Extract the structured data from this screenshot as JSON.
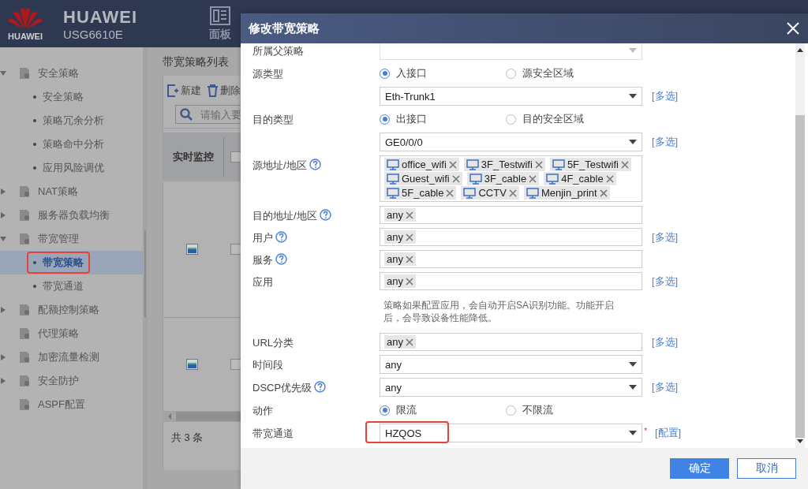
{
  "header": {
    "logo_text": "HUAWEI",
    "brand": "HUAWEI",
    "model": "USG6610E",
    "nav": [
      {
        "label": "面板"
      }
    ]
  },
  "sidebar": {
    "items": [
      {
        "label": "安全策略",
        "kind": "folder",
        "expanded": true,
        "children": [
          {
            "label": "安全策略",
            "selected": false,
            "highlighted": false
          },
          {
            "label": "策略冗余分析",
            "selected": false,
            "highlighted": false
          },
          {
            "label": "策略命中分析",
            "selected": false,
            "highlighted": false
          },
          {
            "label": "应用风险调优",
            "selected": false,
            "highlighted": false
          }
        ]
      },
      {
        "label": "NAT策略",
        "kind": "folder",
        "expanded": false
      },
      {
        "label": "服务器负载均衡",
        "kind": "folder",
        "expanded": false
      },
      {
        "label": "带宽管理",
        "kind": "folder",
        "expanded": true,
        "children": [
          {
            "label": "带宽策略",
            "selected": true,
            "highlighted": true
          },
          {
            "label": "带宽通道",
            "selected": false,
            "highlighted": false
          }
        ]
      },
      {
        "label": "配额控制策略",
        "kind": "folder",
        "expanded": false
      },
      {
        "label": "代理策略",
        "kind": "page"
      },
      {
        "label": "加密流量检测",
        "kind": "folder",
        "expanded": false
      },
      {
        "label": "安全防护",
        "kind": "folder",
        "expanded": false
      },
      {
        "label": "ASPF配置",
        "kind": "page"
      }
    ]
  },
  "list_panel": {
    "title": "带宽策略列表",
    "toolbar": [
      {
        "label": "新建",
        "kind": "new"
      },
      {
        "label": "删除",
        "kind": "delete"
      }
    ],
    "search": {
      "placeholder": "请输入要"
    },
    "columns": [
      "实时监控"
    ],
    "select_all": {
      "checked": false
    },
    "rows": [
      {
        "checked": false
      },
      {
        "checked": false
      }
    ],
    "footer": "共 3 条"
  },
  "dialog": {
    "title": "修改带宽策略",
    "fields": [
      {
        "label": "所属父策略",
        "kind": "select",
        "disabled": true
      },
      {
        "label": "源类型",
        "kind": "radio",
        "options": [
          {
            "label": "入接口",
            "selected": true
          },
          {
            "label": "源安全区域",
            "selected": false
          }
        ]
      },
      {
        "kind": "select",
        "value": "Eth-Trunk1",
        "link": "[多选]"
      },
      {
        "label": "目的类型",
        "kind": "radio",
        "options": [
          {
            "label": "出接口",
            "selected": true
          },
          {
            "label": "目的安全区域",
            "selected": false
          }
        ]
      },
      {
        "kind": "select",
        "value": "GE0/0/0",
        "link": "[多选]"
      },
      {
        "label": "源地址/地区",
        "help": true,
        "kind": "tags",
        "tags": [
          {
            "text": "office_wifi",
            "kind": "device"
          },
          {
            "text": "3F_Testwifi",
            "kind": "device"
          },
          {
            "text": "5F_Testwifi",
            "kind": "device"
          },
          {
            "text": "Guest_wifi",
            "kind": "device"
          },
          {
            "text": "3F_cable",
            "kind": "device"
          },
          {
            "text": "4F_cable",
            "kind": "device"
          },
          {
            "text": "5F_cable",
            "kind": "device"
          },
          {
            "text": "CCTV",
            "kind": "device"
          },
          {
            "text": "Menjin_print",
            "kind": "device"
          }
        ]
      },
      {
        "label": "目的地址/地区",
        "help": true,
        "kind": "tags",
        "tags": [
          {
            "text": "any",
            "kind": "plain"
          }
        ]
      },
      {
        "label": "用户",
        "help": true,
        "kind": "tags",
        "tags": [
          {
            "text": "any",
            "kind": "plain"
          }
        ],
        "link": "[多选]"
      },
      {
        "label": "服务",
        "help": true,
        "kind": "tags",
        "tags": [
          {
            "text": "any",
            "kind": "plain"
          }
        ]
      },
      {
        "label": "应用",
        "kind": "tags",
        "tags": [
          {
            "text": "any",
            "kind": "plain"
          }
        ],
        "link": "[多选]",
        "note": "策略如果配置应用，会自动开启SA识别功能。功能开启后，会导致设备性能降低。"
      },
      {
        "label": "URL分类",
        "kind": "tags",
        "tags": [
          {
            "text": "any",
            "kind": "plain"
          }
        ],
        "link": "[多选]"
      },
      {
        "label": "时间段",
        "kind": "select",
        "value": "any"
      },
      {
        "label": "DSCP优先级",
        "help": true,
        "kind": "select",
        "value": "any",
        "link": "[多选]"
      },
      {
        "label": "动作",
        "kind": "radio",
        "options": [
          {
            "label": "限流",
            "selected": true
          },
          {
            "label": "不限流",
            "selected": false
          }
        ]
      },
      {
        "label": "带宽通道",
        "kind": "select",
        "value": "HZQOS",
        "required_mark": "*",
        "highlighted": true,
        "link": "[配置]"
      }
    ],
    "buttons": [
      {
        "label": "确定",
        "kind": "primary"
      },
      {
        "label": "取消",
        "kind": "secondary"
      }
    ]
  }
}
